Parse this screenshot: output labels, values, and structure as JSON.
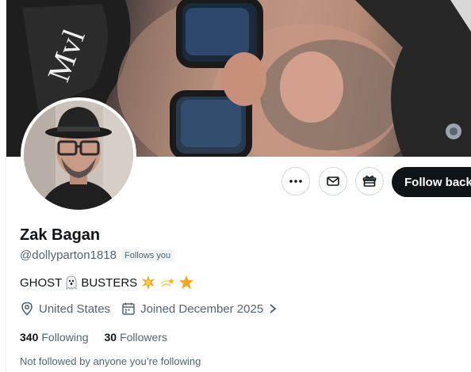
{
  "profile": {
    "name": "Zak Bagan",
    "handle": "@dollyparton1818",
    "follows_you": "Follows you",
    "bio_words": [
      "GHOST",
      "BUSTERS"
    ],
    "location": "United States",
    "joined": "Joined December 2025",
    "following_count": "340",
    "following_label": "Following",
    "followers_count": "30",
    "followers_label": "Followers",
    "followed_note": "Not followed by anyone you’re following"
  },
  "actions": {
    "more_icon": "more-horizontal-icon",
    "message_icon": "envelope-icon",
    "gift_icon": "gift-icon",
    "follow_back_label": "Follow back"
  },
  "colors": {
    "text_primary": "#0f1419",
    "text_secondary": "#536471",
    "button_dark": "#0f1419",
    "border": "#cfd9de"
  }
}
